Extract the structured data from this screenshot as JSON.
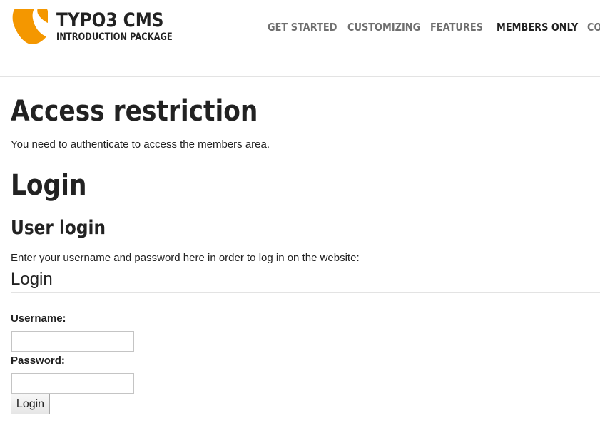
{
  "brand": {
    "title": "TYPO3 CMS",
    "subtitle": "INTRODUCTION PACKAGE",
    "logo_color": "#f49700"
  },
  "nav": {
    "items": [
      {
        "label": "GET STARTED",
        "active": false
      },
      {
        "label": "CUSTOMIZING",
        "active": false
      },
      {
        "label": "FEATURES",
        "active": false
      },
      {
        "label": "MEMBERS ONLY",
        "active": true
      },
      {
        "label": "CO",
        "active": false
      }
    ]
  },
  "page": {
    "title": "Access restriction",
    "intro": "You need to authenticate to access the members area."
  },
  "login": {
    "heading": "Login",
    "user_login_heading": "User login",
    "description": "Enter your username and password here in order to log in on the website:",
    "legend": "Login",
    "username_label": "Username:",
    "username_value": "",
    "password_label": "Password:",
    "password_value": "",
    "submit_label": "Login"
  }
}
